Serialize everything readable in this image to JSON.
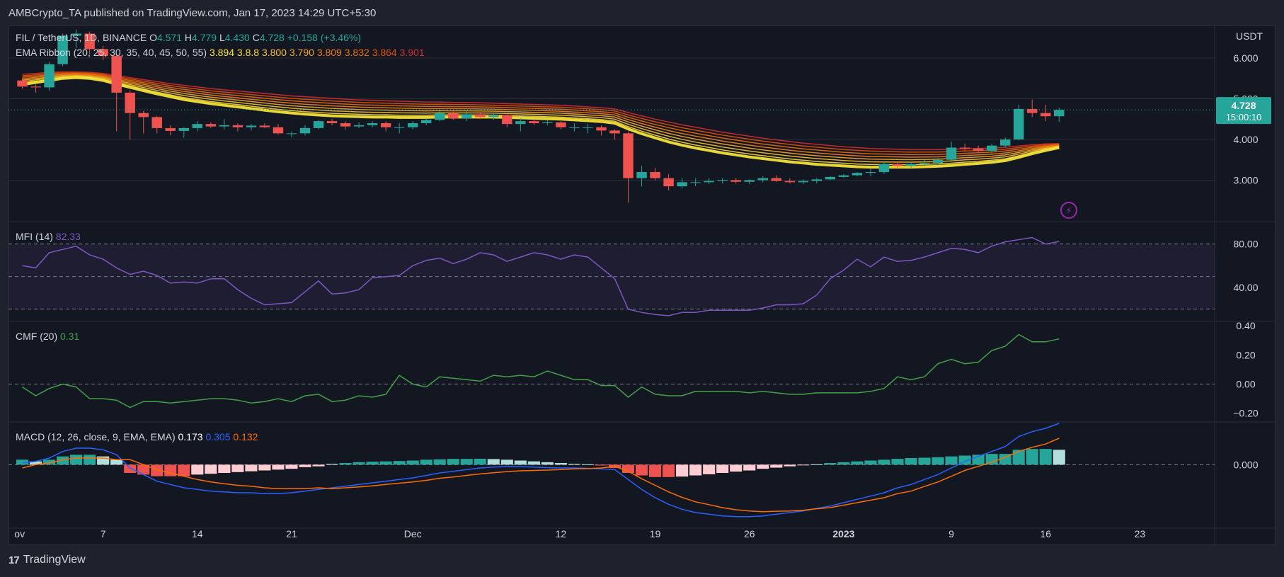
{
  "header": {
    "published": "AMBCrypto_TA published on TradingView.com, Jan 17, 2023 14:29 UTC+5:30"
  },
  "footer": {
    "brand": "TradingView",
    "logo": "tv-logo-icon"
  },
  "colors": {
    "up": "#26a69a",
    "down": "#ef5350",
    "up_light": "#b2dfdb",
    "down_light": "#ffcdd2",
    "mfi": "#7e57c2",
    "cmf": "#43a047",
    "macd": "#2962ff",
    "signal": "#ff6d00",
    "ema": [
      "#ffeb3b",
      "#fdd835",
      "#fbc02d",
      "#f9a825",
      "#f57f17",
      "#ef6c00",
      "#e65100",
      "#d32f2f"
    ],
    "axis_text": "#d1d4dc",
    "grid": "#2a2e39"
  },
  "legend": {
    "symbol": "FIL / TetherUS, 1D, BINANCE",
    "o_label": "O",
    "o": "4.571",
    "h_label": "H",
    "h": "4.779",
    "l_label": "L",
    "l": "4.430",
    "c_label": "C",
    "c": "4.728",
    "chg": "+0.158 (+3.46%)",
    "ema_title": "EMA Ribbon (20, 25, 30, 35, 40, 45, 50, 55)",
    "ema_values": [
      "3.894",
      "3.8.8",
      "3.800",
      "3.790",
      "3.809",
      "3.832",
      "3.864",
      "3.901"
    ],
    "mfi_title": "MFI (14)",
    "mfi_value": "82.33",
    "cmf_title": "CMF (20)",
    "cmf_value": "0.31",
    "macd_title": "MACD (12, 26, close, 9, EMA, EMA)",
    "macd_values": [
      "0.173",
      "0.305",
      "0.132"
    ]
  },
  "price_axis": {
    "unit": "USDT",
    "ticks": [
      "6.000",
      "5.000",
      "4.000",
      "3.000"
    ]
  },
  "mfi_axis": {
    "ticks": [
      "80.00",
      "40.00"
    ]
  },
  "cmf_axis": {
    "ticks": [
      "0.40",
      "0.20",
      "0.00",
      "−0.20"
    ]
  },
  "macd_axis": {
    "ticks": [
      "0.000"
    ]
  },
  "price_badge": {
    "price": "4.728",
    "countdown": "15:00:10"
  },
  "alert_icon": "lightning-icon",
  "x_axis": {
    "labels": [
      "ov",
      "7",
      "14",
      "21",
      "Dec",
      "12",
      "19",
      "26",
      "2023",
      "9",
      "16",
      "23"
    ]
  },
  "chart_data": [
    {
      "type": "candlestick",
      "title": "FIL / TetherUS, 1D, BINANCE",
      "ylabel": "USDT",
      "ylim": [
        2.0,
        6.8
      ],
      "dates": [
        "2022-11-01",
        "2022-11-02",
        "2022-11-03",
        "2022-11-04",
        "2022-11-05",
        "2022-11-06",
        "2022-11-07",
        "2022-11-08",
        "2022-11-09",
        "2022-11-10",
        "2022-11-11",
        "2022-11-12",
        "2022-11-13",
        "2022-11-14",
        "2022-11-15",
        "2022-11-16",
        "2022-11-17",
        "2022-11-18",
        "2022-11-19",
        "2022-11-20",
        "2022-11-21",
        "2022-11-22",
        "2022-11-23",
        "2022-11-24",
        "2022-11-25",
        "2022-11-26",
        "2022-11-27",
        "2022-11-28",
        "2022-11-29",
        "2022-11-30",
        "2022-12-01",
        "2022-12-02",
        "2022-12-03",
        "2022-12-04",
        "2022-12-05",
        "2022-12-06",
        "2022-12-07",
        "2022-12-08",
        "2022-12-09",
        "2022-12-10",
        "2022-12-11",
        "2022-12-12",
        "2022-12-13",
        "2022-12-14",
        "2022-12-15",
        "2022-12-16",
        "2022-12-17",
        "2022-12-18",
        "2022-12-19",
        "2022-12-20",
        "2022-12-21",
        "2022-12-22",
        "2022-12-23",
        "2022-12-24",
        "2022-12-25",
        "2022-12-26",
        "2022-12-27",
        "2022-12-28",
        "2022-12-29",
        "2022-12-30",
        "2022-12-31",
        "2023-01-01",
        "2023-01-02",
        "2023-01-03",
        "2023-01-04",
        "2023-01-05",
        "2023-01-06",
        "2023-01-07",
        "2023-01-08",
        "2023-01-09",
        "2023-01-10",
        "2023-01-11",
        "2023-01-12",
        "2023-01-13",
        "2023-01-14",
        "2023-01-15",
        "2023-01-16",
        "2023-01-17"
      ],
      "open": [
        5.45,
        5.3,
        5.28,
        5.85,
        6.55,
        6.6,
        6.22,
        6.05,
        5.15,
        4.65,
        4.55,
        4.28,
        4.21,
        4.28,
        4.38,
        4.32,
        4.35,
        4.3,
        4.34,
        4.3,
        4.15,
        4.15,
        4.28,
        4.45,
        4.4,
        4.32,
        4.35,
        4.4,
        4.3,
        4.3,
        4.4,
        4.48,
        4.65,
        4.52,
        4.62,
        4.55,
        4.6,
        4.38,
        4.45,
        4.4,
        4.42,
        4.3,
        4.3,
        4.3,
        4.22,
        4.15,
        3.05,
        3.2,
        3.05,
        2.85,
        2.95,
        2.95,
        2.98,
        3.0,
        2.96,
        3.0,
        3.05,
        2.98,
        2.95,
        2.98,
        3.02,
        3.08,
        3.12,
        3.18,
        3.2,
        3.4,
        3.35,
        3.4,
        3.42,
        3.5,
        3.8,
        3.78,
        3.72,
        3.85,
        4.0,
        4.75,
        4.65,
        4.57
      ],
      "high": [
        5.5,
        5.35,
        5.9,
        6.6,
        6.7,
        6.65,
        6.3,
        6.1,
        5.2,
        4.7,
        4.58,
        4.35,
        4.3,
        4.45,
        4.42,
        4.5,
        4.4,
        4.38,
        4.4,
        4.38,
        4.2,
        4.35,
        4.48,
        4.5,
        4.45,
        4.42,
        4.45,
        4.45,
        4.4,
        4.45,
        4.52,
        4.7,
        4.72,
        4.7,
        4.68,
        4.65,
        4.62,
        4.52,
        4.5,
        4.48,
        4.45,
        4.4,
        4.38,
        4.35,
        4.25,
        4.2,
        3.35,
        3.3,
        3.15,
        3.05,
        3.05,
        3.05,
        3.05,
        3.05,
        3.02,
        3.1,
        3.12,
        3.05,
        3.02,
        3.05,
        3.1,
        3.15,
        3.2,
        3.3,
        3.45,
        3.45,
        3.45,
        3.5,
        3.55,
        3.95,
        3.9,
        3.85,
        3.9,
        4.05,
        4.85,
        4.98,
        4.85,
        4.78
      ],
      "low": [
        5.25,
        5.15,
        5.2,
        5.8,
        6.25,
        6.1,
        5.95,
        4.2,
        4.0,
        4.15,
        4.15,
        4.1,
        4.05,
        4.2,
        4.28,
        4.25,
        4.2,
        4.22,
        4.28,
        4.12,
        4.05,
        4.1,
        4.25,
        4.35,
        4.25,
        4.28,
        4.3,
        4.2,
        4.15,
        4.25,
        4.35,
        4.45,
        4.48,
        4.45,
        4.5,
        4.48,
        4.3,
        4.2,
        4.35,
        4.35,
        4.25,
        4.2,
        4.15,
        4.1,
        4.0,
        2.45,
        2.85,
        3.0,
        2.75,
        2.8,
        2.85,
        2.9,
        2.92,
        2.92,
        2.9,
        2.95,
        2.96,
        2.92,
        2.9,
        2.92,
        3.0,
        3.05,
        3.1,
        3.1,
        3.15,
        3.3,
        3.3,
        3.35,
        3.38,
        3.45,
        3.7,
        3.68,
        3.65,
        3.8,
        3.98,
        4.55,
        4.45,
        4.43
      ],
      "close": [
        5.3,
        5.28,
        5.85,
        6.55,
        6.6,
        6.22,
        6.05,
        5.15,
        4.65,
        4.55,
        4.28,
        4.21,
        4.28,
        4.38,
        4.32,
        4.35,
        4.3,
        4.34,
        4.3,
        4.15,
        4.15,
        4.28,
        4.45,
        4.4,
        4.32,
        4.35,
        4.4,
        4.3,
        4.3,
        4.4,
        4.48,
        4.65,
        4.52,
        4.62,
        4.55,
        4.6,
        4.38,
        4.45,
        4.4,
        4.42,
        4.3,
        4.3,
        4.3,
        4.22,
        4.15,
        3.05,
        3.2,
        3.05,
        2.85,
        2.95,
        2.95,
        2.98,
        3.0,
        2.96,
        3.0,
        3.05,
        2.98,
        2.95,
        2.98,
        3.02,
        3.08,
        3.12,
        3.18,
        3.2,
        3.4,
        3.35,
        3.4,
        3.42,
        3.5,
        3.8,
        3.78,
        3.72,
        3.85,
        4.0,
        4.75,
        4.65,
        4.57,
        4.728
      ],
      "ema_ribbon_bottom": [
        5.35,
        5.4,
        5.45,
        5.5,
        5.52,
        5.5,
        5.45,
        5.36,
        5.28,
        5.2,
        5.12,
        5.05,
        4.98,
        4.93,
        4.88,
        4.84,
        4.8,
        4.76,
        4.72,
        4.68,
        4.65,
        4.62,
        4.6,
        4.58,
        4.57,
        4.56,
        4.55,
        4.55,
        4.54,
        4.54,
        4.54,
        4.55,
        4.55,
        4.55,
        4.55,
        4.55,
        4.54,
        4.53,
        4.52,
        4.51,
        4.5,
        4.48,
        4.46,
        4.44,
        4.4,
        4.26,
        4.14,
        4.04,
        3.94,
        3.86,
        3.79,
        3.73,
        3.67,
        3.62,
        3.57,
        3.53,
        3.49,
        3.45,
        3.42,
        3.39,
        3.37,
        3.35,
        3.33,
        3.32,
        3.32,
        3.32,
        3.32,
        3.33,
        3.34,
        3.36,
        3.39,
        3.41,
        3.44,
        3.48,
        3.56,
        3.65,
        3.73,
        3.8
      ],
      "ema_ribbon_top": [
        5.6,
        5.62,
        5.65,
        5.66,
        5.66,
        5.65,
        5.62,
        5.57,
        5.52,
        5.47,
        5.42,
        5.37,
        5.33,
        5.29,
        5.25,
        5.22,
        5.19,
        5.16,
        5.13,
        5.1,
        5.07,
        5.05,
        5.03,
        5.01,
        4.99,
        4.97,
        4.96,
        4.95,
        4.94,
        4.93,
        4.92,
        4.92,
        4.91,
        4.91,
        4.9,
        4.89,
        4.88,
        4.87,
        4.86,
        4.85,
        4.84,
        4.82,
        4.8,
        4.78,
        4.75,
        4.66,
        4.58,
        4.5,
        4.43,
        4.36,
        4.3,
        4.24,
        4.18,
        4.13,
        4.08,
        4.03,
        3.99,
        3.95,
        3.91,
        3.88,
        3.85,
        3.82,
        3.8,
        3.78,
        3.77,
        3.76,
        3.75,
        3.75,
        3.75,
        3.76,
        3.77,
        3.78,
        3.79,
        3.81,
        3.84,
        3.87,
        3.89,
        3.9
      ]
    },
    {
      "type": "line",
      "title": "MFI (14)",
      "ylim": [
        10,
        100
      ],
      "bands": [
        80,
        50,
        20
      ],
      "values": [
        60,
        58,
        72,
        75,
        78,
        70,
        66,
        58,
        52,
        55,
        51,
        44,
        45,
        44,
        48,
        48,
        38,
        30,
        24,
        25,
        26,
        36,
        46,
        34,
        35,
        38,
        49,
        50,
        51,
        60,
        65,
        67,
        62,
        66,
        72,
        70,
        64,
        68,
        72,
        70,
        66,
        70,
        68,
        58,
        48,
        20,
        17,
        15,
        14,
        17,
        17,
        19,
        19,
        19,
        19,
        21,
        24,
        24,
        25,
        33,
        48,
        56,
        66,
        59,
        68,
        64,
        65,
        68,
        72,
        76,
        75,
        72,
        78,
        82,
        84,
        86,
        80,
        82.33
      ]
    },
    {
      "type": "line",
      "title": "CMF (20)",
      "ylim": [
        -0.25,
        0.42
      ],
      "values": [
        -0.02,
        -0.08,
        -0.03,
        0.0,
        -0.02,
        -0.1,
        -0.1,
        -0.11,
        -0.16,
        -0.12,
        -0.12,
        -0.13,
        -0.12,
        -0.11,
        -0.1,
        -0.1,
        -0.11,
        -0.13,
        -0.12,
        -0.1,
        -0.12,
        -0.08,
        -0.07,
        -0.12,
        -0.11,
        -0.08,
        -0.09,
        -0.07,
        0.06,
        0.0,
        -0.02,
        0.05,
        0.04,
        0.03,
        0.02,
        0.06,
        0.05,
        0.06,
        0.05,
        0.09,
        0.06,
        0.03,
        0.03,
        -0.01,
        -0.01,
        -0.09,
        -0.02,
        -0.07,
        -0.08,
        -0.08,
        -0.05,
        -0.05,
        -0.05,
        -0.05,
        -0.06,
        -0.05,
        -0.06,
        -0.07,
        -0.07,
        -0.06,
        -0.06,
        -0.06,
        -0.06,
        -0.05,
        -0.03,
        0.05,
        0.03,
        0.05,
        0.14,
        0.17,
        0.14,
        0.15,
        0.23,
        0.26,
        0.34,
        0.29,
        0.29,
        0.31
      ]
    },
    {
      "type": "bar+line",
      "title": "MACD (12, 26, close, 9, EMA, EMA)",
      "ylim": [
        -0.38,
        0.25
      ],
      "histogram": [
        0.03,
        0.02,
        0.03,
        0.05,
        0.06,
        0.06,
        0.05,
        0.03,
        -0.05,
        -0.06,
        -0.07,
        -0.07,
        -0.07,
        -0.06,
        -0.055,
        -0.05,
        -0.045,
        -0.04,
        -0.035,
        -0.03,
        -0.025,
        -0.015,
        -0.01,
        0.005,
        0.01,
        0.015,
        0.018,
        0.02,
        0.022,
        0.025,
        0.03,
        0.032,
        0.035,
        0.035,
        0.036,
        0.034,
        0.03,
        0.025,
        0.02,
        0.015,
        0.01,
        0.005,
        0.002,
        -0.005,
        -0.02,
        -0.05,
        -0.065,
        -0.075,
        -0.075,
        -0.072,
        -0.065,
        -0.058,
        -0.05,
        -0.042,
        -0.035,
        -0.025,
        -0.018,
        -0.01,
        -0.004,
        0.002,
        0.01,
        0.015,
        0.02,
        0.025,
        0.03,
        0.035,
        0.04,
        0.042,
        0.045,
        0.05,
        0.055,
        0.06,
        0.065,
        0.065,
        0.09,
        0.095,
        0.095,
        0.09
      ]
    }
  ]
}
